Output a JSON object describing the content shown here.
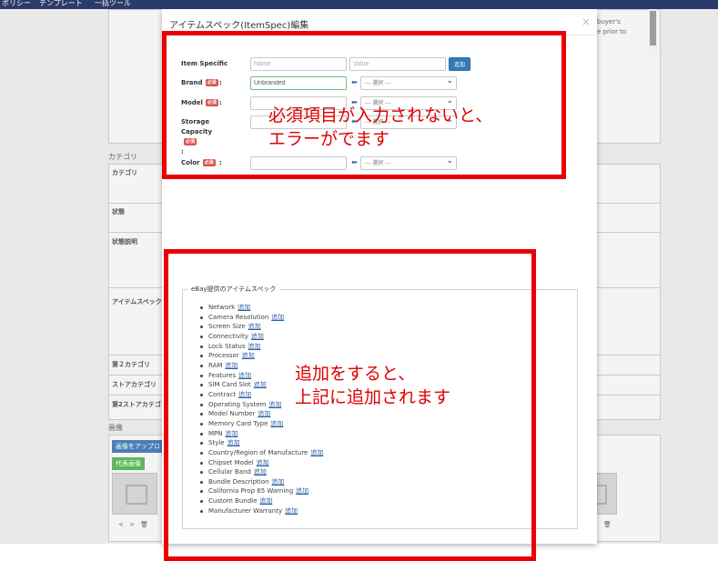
{
  "topnav": {
    "items": [
      "ポリシー",
      "テンプレート",
      "一括ツール"
    ]
  },
  "background": {
    "right_text_1": "buyer's",
    "right_text_2": "e prior to",
    "section_category": "カテゴリ",
    "row_category": "カテゴリ",
    "row_condition": "状態",
    "row_condition_desc": "状態説明",
    "row_item_spec": "アイテムスペック",
    "row_second_category": "第２カテゴリ",
    "row_store_category": "ストアカテゴリ",
    "row_second_store_category": "第2ストアカテゴ",
    "section_images": "画像",
    "upload_button": "画像をアップロ",
    "main_image_badge": "代表画像",
    "thumb_controls": "< > 🗑"
  },
  "modal": {
    "title": "アイテムスペック(ItemSpec)編集",
    "close": "×",
    "item_specific_label": "Item Specific",
    "name_placeholder": "Name",
    "value_placeholder": "Value",
    "add_button": "追加",
    "required_badge": "必須",
    "fields": [
      {
        "label": "Brand",
        "value": "Unbranded",
        "select": "--- 選択 ---"
      },
      {
        "label": "Model",
        "value": "",
        "select": "--- 選択 ---"
      },
      {
        "label": "Storage Capacity",
        "value": "",
        "select": "--- 選択 ---"
      },
      {
        "label": "Color",
        "value": "",
        "select": "--- 選択 ---"
      }
    ],
    "ebay_legend": "eBay提供のアイテムスペック",
    "add_link": "追加",
    "ebay_specs": [
      "Network",
      "Camera Resolution",
      "Screen Size",
      "Connectivity",
      "Lock Status",
      "Processor",
      "RAM",
      "Features",
      "SIM Card Slot",
      "Contract",
      "Operating System",
      "Model Number",
      "Memory Card Type",
      "MPN",
      "Style",
      "Country/Region of Manufacture",
      "Chipset Model",
      "Cellular Band",
      "Bundle Description",
      "California Prop 65 Warning",
      "Custom Bundle",
      "Manufacturer Warranty"
    ]
  },
  "annotations": {
    "top_line1": "必須項目が入力されないと、",
    "top_line2": "エラーがでます",
    "bottom_line1": "追加をすると、",
    "bottom_line2": "上記に追加されます",
    "box_color": "#ea0000"
  }
}
